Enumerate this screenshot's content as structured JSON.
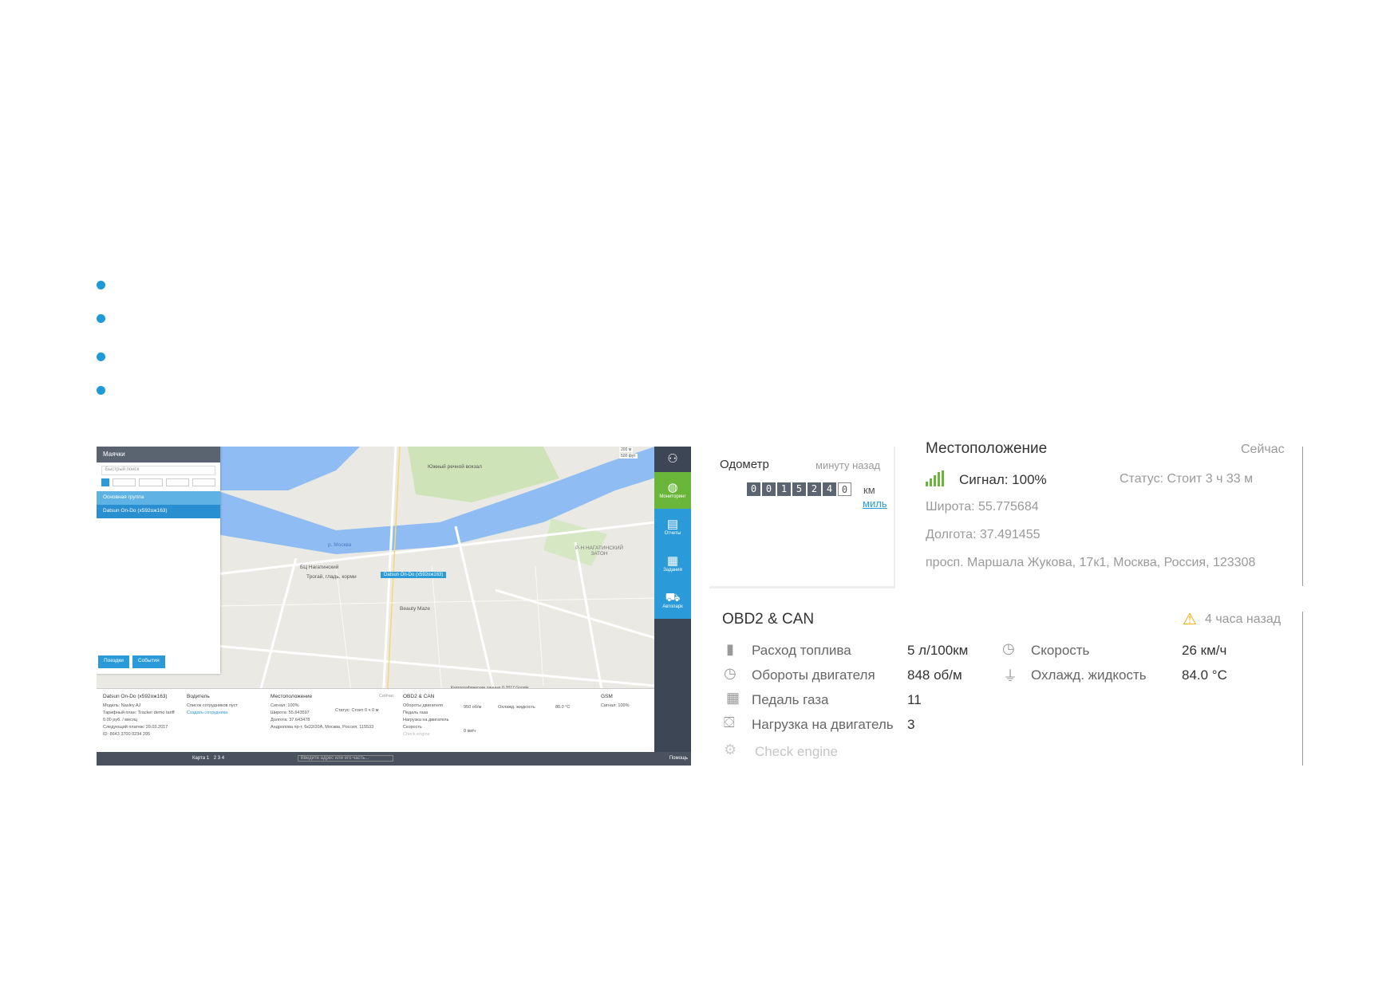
{
  "left_app": {
    "panel": {
      "title": "Маячки",
      "search_placeholder": "Быстрый поиск",
      "group": "Основная группа",
      "vehicle": "Datsun On-Do (x592oж163)",
      "trips_button": "Поездки",
      "events_button": "События"
    },
    "sidebar": [
      "Мониторинг",
      "Отчеты",
      "Задания",
      "Автопарк"
    ],
    "map_labels": {
      "l1": "Южный речной вокзал",
      "l2": "р. Москва",
      "l3": "Р-Н НАГАТИНСКИЙ ЗАТОН",
      "l4": "БЦ Нагатинский",
      "l5": "Трогай, гладь, корми",
      "l6": "Beauty Maze",
      "l7": "Datsun On-Do (x592oж163)",
      "scale1": "200 м",
      "scale2": "500 фут",
      "attribution": "Картографические данные © 2017 Google"
    },
    "bottom": {
      "c1_title": "Datsun On-Do (x592oж163)",
      "c1_l1": "Модель: Nasley AJ",
      "c1_l2": "Тарифный план: Tracker demo tariff",
      "c1_l3": "0.00 руб. / месяц",
      "c1_l4": "Следующий платеж: 29.03.2017",
      "c1_l5": "ID: 8643 3700 0234 295",
      "c2_title": "Водитель",
      "c2_l1": "Список сотрудников пуст",
      "c2_l2": "Создать сотрудника",
      "c3_title": "Местоположение",
      "c3_l1": "Сигнал: 100%",
      "c3_l2": "Статус: Стоит 0 ч 0 м",
      "c3_l3": "Широта: 55.643597",
      "c3_l4": "Долгота: 37.643478",
      "c3_l5": "Андропова пр-т, 6к22/20А, Москва, Россия, 115533",
      "c4_title": "OBD2 & CAN",
      "c4_l1": "Обороты двигателя",
      "c4_l2": "Педаль газа",
      "c4_l3": "Нагрузка на двигатель",
      "c4_l4": "Скорость",
      "c4_l5": "Check engine",
      "c4_v1": "950 об/м",
      "c4_v4": "0 км/ч",
      "c4_r1": "Охлажд. жидкость",
      "c4_r1v": "80.0 °C",
      "c5_title": "GSM",
      "c5_l1": "Сигнал: 100%",
      "now": "Сейчас"
    },
    "footer": {
      "map_tab": "Карта 1",
      "pages": "2 3 4",
      "address_placeholder": "Введите адрес или его часть...",
      "help": "Помощь"
    }
  },
  "zoom": {
    "odometer": {
      "title": "Одометр",
      "time": "минуту назад",
      "digits": [
        "0",
        "0",
        "1",
        "5",
        "2",
        "4",
        "0"
      ],
      "unit": "км",
      "alt_unit": "миль"
    },
    "location": {
      "title": "Местоположение",
      "time": "Сейчас",
      "signal": "Сигнал: 100%",
      "status": "Статус: Стоит 3 ч 33 м",
      "lat": "Широта: 55.775684",
      "lon": "Долгота: 37.491455",
      "address": "просп. Маршала Жукова, 17к1, Москва, Россия, 123308"
    },
    "obd": {
      "title": "OBD2 & CAN",
      "time": "4 часа назад",
      "fuel_label": "Расход топлива",
      "fuel_value": "5 л/100км",
      "rpm_label": "Обороты двигателя",
      "rpm_value": "848 об/м",
      "pedal_label": "Педаль газа",
      "pedal_value": "11",
      "load_label": "Нагрузка на двигатель",
      "load_value": "3",
      "check_engine": "Check engine",
      "speed_label": "Скорость",
      "speed_value": "26 км/ч",
      "coolant_label": "Охлажд. жидкость",
      "coolant_value": "84.0 °C"
    }
  },
  "colors": {
    "bullet": "#1d9bd8",
    "accent_blue": "#2a9bd8",
    "sidebar_green": "#6ab63a",
    "river": "#8fbcf2",
    "warning": "#f0a800"
  }
}
